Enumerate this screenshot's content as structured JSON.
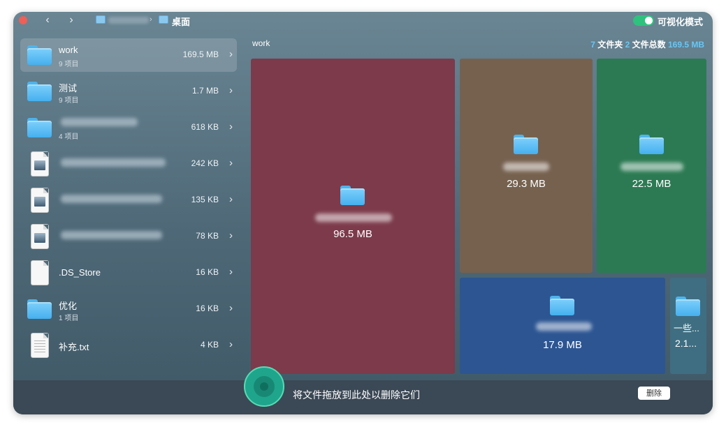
{
  "titlebar": {
    "back_label": "‹",
    "forward_label": "›",
    "breadcrumb_current": "桌面",
    "toggle_label": "可视化模式",
    "toggle_on": true
  },
  "sidebar": {
    "items": [
      {
        "name": "work",
        "sub": "9 项目",
        "size": "169.5 MB",
        "type": "folder",
        "selected": true
      },
      {
        "name": "测试",
        "sub": "9 项目",
        "size": "1.7 MB",
        "type": "folder"
      },
      {
        "name": "",
        "sub": "4 项目",
        "size": "618 KB",
        "type": "folder"
      },
      {
        "name": "",
        "sub": "",
        "size": "242 KB",
        "type": "image-file"
      },
      {
        "name": "",
        "sub": "",
        "size": "135 KB",
        "type": "image-file"
      },
      {
        "name": "",
        "sub": "",
        "size": "78 KB",
        "type": "image-file"
      },
      {
        "name": ".DS_Store",
        "sub": "",
        "size": "16 KB",
        "type": "file"
      },
      {
        "name": "优化",
        "sub": "1 项目",
        "size": "16 KB",
        "type": "folder"
      },
      {
        "name": "补充.txt",
        "sub": "",
        "size": "4 KB",
        "type": "text-file"
      }
    ]
  },
  "main": {
    "title": "work",
    "stats": {
      "folders_count": "7",
      "folders_label": "文件夹",
      "files_count": "2",
      "files_label": "文件总数",
      "total_size": "169.5 MB"
    },
    "tiles": [
      {
        "label": "",
        "size": "96.5 MB",
        "color": "#7c3a4a"
      },
      {
        "label": "",
        "size": "29.3 MB",
        "color": "#76614f"
      },
      {
        "label": "",
        "size": "22.5 MB",
        "color": "#2c7a53"
      },
      {
        "label": "",
        "size": "17.9 MB",
        "color": "#2c5592"
      },
      {
        "label": "一些...",
        "size": "2.1...",
        "color": "#3f6e82"
      }
    ]
  },
  "bottom": {
    "drop_text": "将文件拖放到此处以删除它们",
    "delete_label": "删除"
  }
}
